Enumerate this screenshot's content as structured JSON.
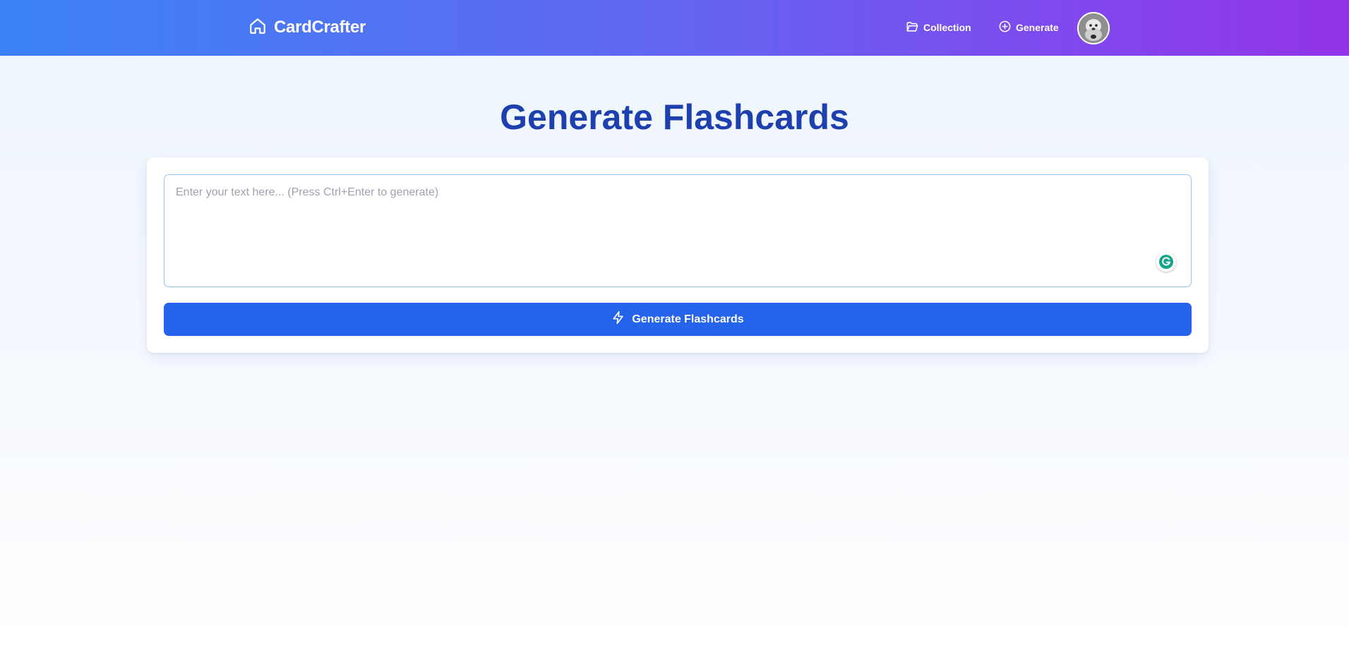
{
  "app": {
    "name": "CardCrafter",
    "logo_icon": "home-icon",
    "accent_colors": {
      "nav_gradient_start": "#3b82f6",
      "nav_gradient_mid": "#6366f1",
      "nav_gradient_end": "#9333ea",
      "title": "#1e40af",
      "button": "#2563eb"
    }
  },
  "nav": {
    "items": [
      {
        "label": "Collection",
        "icon": "folder-open-icon"
      },
      {
        "label": "Generate",
        "icon": "plus-circle-icon"
      }
    ],
    "avatar_icon": "user-avatar"
  },
  "main": {
    "title": "Generate Flashcards",
    "input": {
      "value": "",
      "placeholder": "Enter your text here... (Press Ctrl+Enter to generate)"
    },
    "grammarly_icon": "grammarly-icon",
    "generate_button": {
      "label": "Generate Flashcards",
      "icon": "lightning-icon"
    }
  }
}
